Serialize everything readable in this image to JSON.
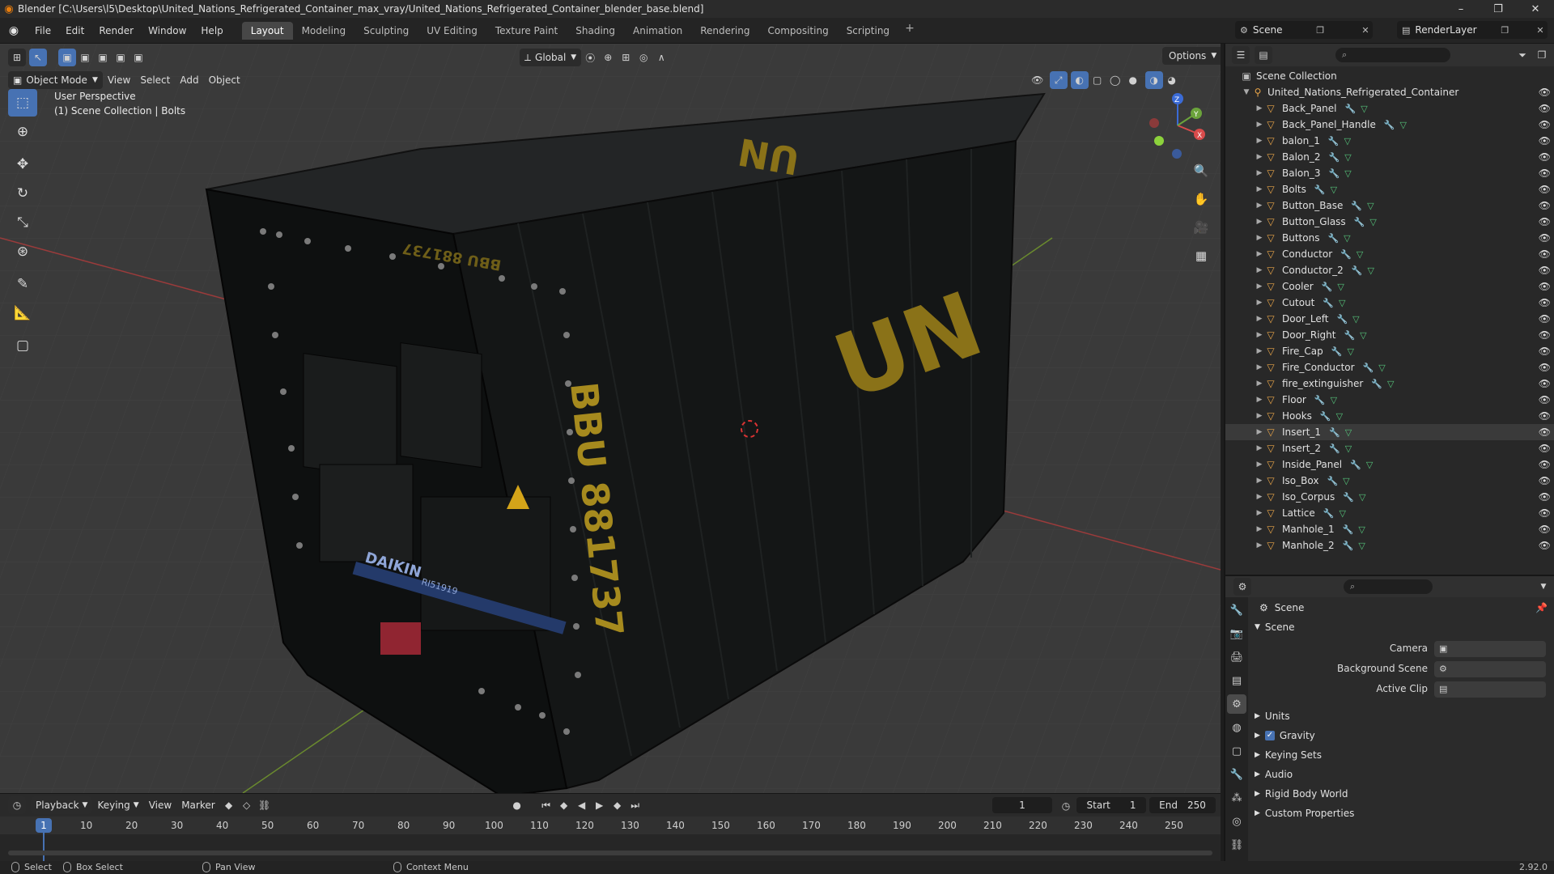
{
  "window": {
    "title": "Blender [C:\\Users\\l5\\Desktop\\United_Nations_Refrigerated_Container_max_vray/United_Nations_Refrigerated_Container_blender_base.blend]"
  },
  "menu": [
    "File",
    "Edit",
    "Render",
    "Window",
    "Help"
  ],
  "workspaces": [
    "Layout",
    "Modeling",
    "Sculpting",
    "UV Editing",
    "Texture Paint",
    "Shading",
    "Animation",
    "Rendering",
    "Compositing",
    "Scripting"
  ],
  "active_workspace": "Layout",
  "scene_name": "Scene",
  "render_layer": "RenderLayer",
  "viewport": {
    "mode": "Object Mode",
    "menus": [
      "View",
      "Select",
      "Add",
      "Object"
    ],
    "orientation": "Global",
    "options": "Options",
    "info_line1": "User Perspective",
    "info_line2": "(1) Scene Collection | Bolts",
    "container_side_text": "BBU 881737",
    "container_logo": "UN",
    "container_top_text": "BBU 881737",
    "brand": "DAIKIN",
    "model": "RI51919",
    "axes": {
      "x": "X",
      "y": "Y",
      "z": "Z"
    }
  },
  "outliner": {
    "root": "Scene Collection",
    "collection": "United_Nations_Refrigerated_Container",
    "items": [
      {
        "name": "Back_Panel",
        "selected": false
      },
      {
        "name": "Back_Panel_Handle",
        "selected": false
      },
      {
        "name": "balon_1",
        "selected": false
      },
      {
        "name": "Balon_2",
        "selected": false
      },
      {
        "name": "Balon_3",
        "selected": false
      },
      {
        "name": "Bolts",
        "selected": false
      },
      {
        "name": "Button_Base",
        "selected": false
      },
      {
        "name": "Button_Glass",
        "selected": false
      },
      {
        "name": "Buttons",
        "selected": false
      },
      {
        "name": "Conductor",
        "selected": false
      },
      {
        "name": "Conductor_2",
        "selected": false
      },
      {
        "name": "Cooler",
        "selected": false
      },
      {
        "name": "Cutout",
        "selected": false
      },
      {
        "name": "Door_Left",
        "selected": false
      },
      {
        "name": "Door_Right",
        "selected": false
      },
      {
        "name": "Fire_Cap",
        "selected": false
      },
      {
        "name": "Fire_Conductor",
        "selected": false
      },
      {
        "name": "fire_extinguisher",
        "selected": false
      },
      {
        "name": "Floor",
        "selected": false
      },
      {
        "name": "Hooks",
        "selected": false
      },
      {
        "name": "Insert_1",
        "selected": true
      },
      {
        "name": "Insert_2",
        "selected": false
      },
      {
        "name": "Inside_Panel",
        "selected": false
      },
      {
        "name": "Iso_Box",
        "selected": false
      },
      {
        "name": "Iso_Corpus",
        "selected": false
      },
      {
        "name": "Lattice",
        "selected": false
      },
      {
        "name": "Manhole_1",
        "selected": false
      },
      {
        "name": "Manhole_2",
        "selected": false
      }
    ]
  },
  "properties": {
    "title": "Scene",
    "section": "Scene",
    "fields": [
      {
        "label": "Camera",
        "value": ""
      },
      {
        "label": "Background Scene",
        "value": ""
      },
      {
        "label": "Active Clip",
        "value": ""
      }
    ],
    "panels": [
      "Units",
      "Gravity",
      "Keying Sets",
      "Audio",
      "Rigid Body World",
      "Custom Properties"
    ],
    "gravity_checked": true
  },
  "timeline": {
    "menus": [
      "Playback",
      "Keying",
      "View",
      "Marker"
    ],
    "current_frame": "1",
    "start_label": "Start",
    "start": "1",
    "end_label": "End",
    "end": "250",
    "ticks": [
      "10",
      "20",
      "30",
      "40",
      "50",
      "60",
      "70",
      "80",
      "90",
      "100",
      "110",
      "120",
      "130",
      "140",
      "150",
      "160",
      "170",
      "180",
      "190",
      "200",
      "210",
      "220",
      "230",
      "240",
      "250"
    ],
    "marker": "1"
  },
  "status": {
    "select": "Select",
    "box_select": "Box Select",
    "pan": "Pan View",
    "context": "Context Menu",
    "version": "2.92.0"
  }
}
